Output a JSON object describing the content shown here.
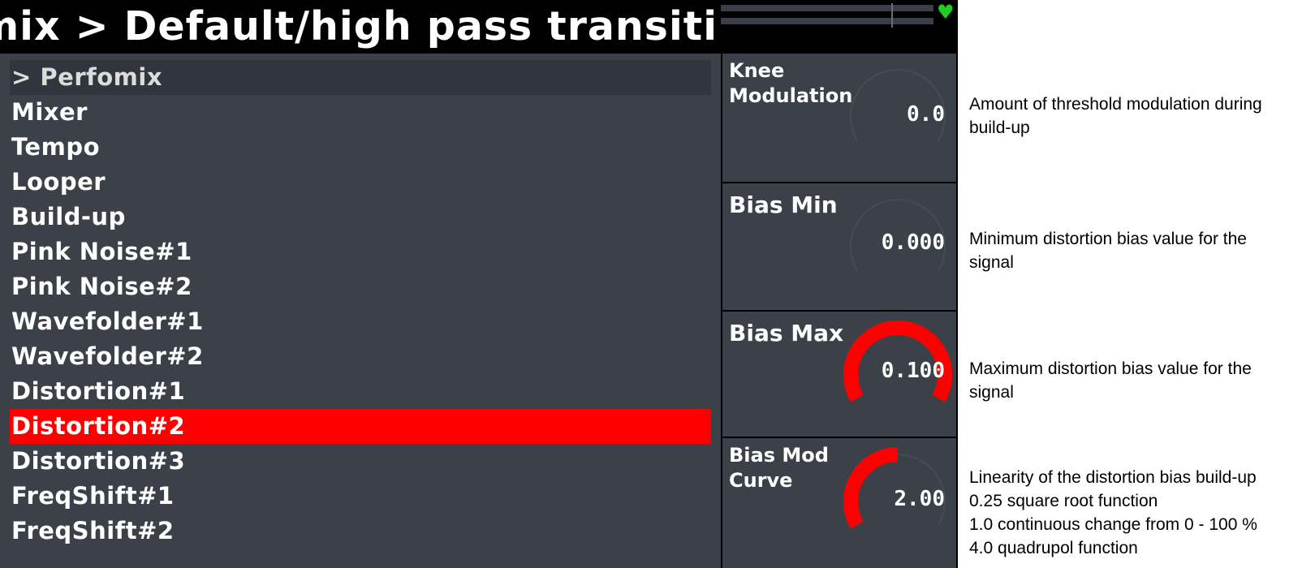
{
  "title": "omix > Default/high pass transiti",
  "menu": {
    "items": [
      {
        "label": "> Perfomix",
        "state": "header"
      },
      {
        "label": "Mixer",
        "state": "normal"
      },
      {
        "label": "Tempo",
        "state": "normal"
      },
      {
        "label": "Looper",
        "state": "normal"
      },
      {
        "label": "Build-up",
        "state": "normal"
      },
      {
        "label": "Pink Noise#1",
        "state": "normal"
      },
      {
        "label": "Pink Noise#2",
        "state": "normal"
      },
      {
        "label": "Wavefolder#1",
        "state": "normal"
      },
      {
        "label": "Wavefolder#2",
        "state": "normal"
      },
      {
        "label": "Distortion#1",
        "state": "normal"
      },
      {
        "label": "Distortion#2",
        "state": "selected"
      },
      {
        "label": "Distortion#3",
        "state": "normal"
      },
      {
        "label": "FreqShift#1",
        "state": "normal"
      },
      {
        "label": "FreqShift#2",
        "state": "normal"
      }
    ]
  },
  "params": [
    {
      "label": "Knee\nModulation",
      "value": "0.0",
      "knob_fraction": 0.0,
      "knob_start_fraction": 0.0
    },
    {
      "label": "Bias Min",
      "value": "0.000",
      "knob_fraction": 0.0,
      "knob_start_fraction": 0.0
    },
    {
      "label": "Bias Max",
      "value": "0.100",
      "knob_fraction": 1.0,
      "knob_start_fraction": 0.0
    },
    {
      "label": "Bias Mod\nCurve",
      "value": "2.00",
      "knob_fraction": 0.5,
      "knob_start_fraction": 0.0
    }
  ],
  "descriptions": [
    {
      "lines": [
        "Amount of threshold modulation during",
        "build-up"
      ]
    },
    {
      "lines": [
        "Minimum distortion bias value for the",
        "signal"
      ]
    },
    {
      "lines": [
        "Maximum distortion bias value for the",
        "signal"
      ]
    },
    {
      "lines": [
        "Linearity of the distortion bias build-up",
        "0.25 square root function",
        "1.0 continuous change from 0 - 100 %",
        "4.0 quadrupol function"
      ]
    }
  ],
  "status": {
    "icon": "heart-icon"
  },
  "colors": {
    "selected": "#ff0000",
    "knob_arc": "#ff0000",
    "panel": "#3b4049",
    "header_row": "#31353d",
    "heart": "#22cc22"
  }
}
